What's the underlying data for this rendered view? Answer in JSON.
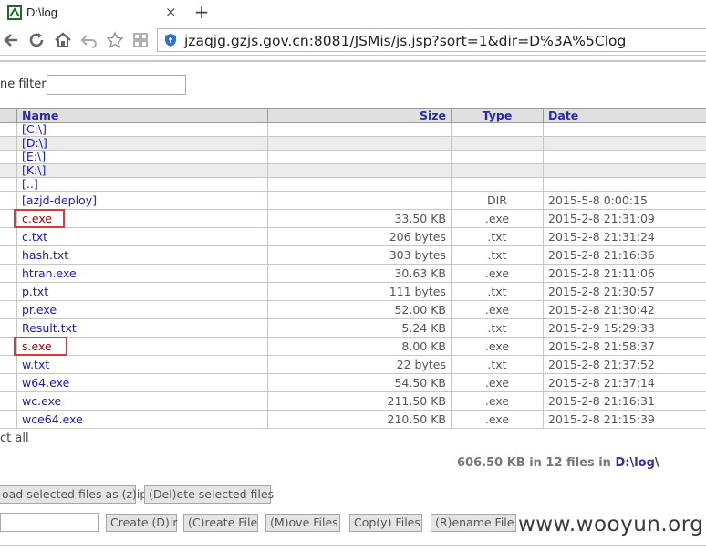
{
  "browser": {
    "tab_title": "D:\\log",
    "tab_close": "×",
    "new_tab": "+",
    "url": "jzaqjg.gzjs.gov.cn:8081/JSMis/js.jsp?sort=1&dir=D%3A%5Clog"
  },
  "filter": {
    "label": "ne filter:",
    "value": ""
  },
  "table": {
    "headers": {
      "name": "Name",
      "size": "Size",
      "type": "Type",
      "date": "Date"
    },
    "drives": [
      "[C:\\]",
      "[D:\\]",
      "[E:\\]",
      "[K:\\]",
      "[..]"
    ],
    "rows": [
      {
        "name": "[azjd-deploy]",
        "size": "",
        "type": "DIR",
        "date": "2015-5-8 0:00:15"
      },
      {
        "name": "c.exe",
        "size": "33.50 KB",
        "type": ".exe",
        "date": "2015-2-8 21:31:09"
      },
      {
        "name": "c.txt",
        "size": "206 bytes",
        "type": ".txt",
        "date": "2015-2-8 21:31:24"
      },
      {
        "name": "hash.txt",
        "size": "303 bytes",
        "type": ".txt",
        "date": "2015-2-8 21:16:36"
      },
      {
        "name": "htran.exe",
        "size": "30.63 KB",
        "type": ".exe",
        "date": "2015-2-8 21:11:06"
      },
      {
        "name": "p.txt",
        "size": "111 bytes",
        "type": ".txt",
        "date": "2015-2-8 21:30:57"
      },
      {
        "name": "pr.exe",
        "size": "52.00 KB",
        "type": ".exe",
        "date": "2015-2-8 21:30:42"
      },
      {
        "name": "Result.txt",
        "size": "5.24 KB",
        "type": ".txt",
        "date": "2015-2-9 15:29:33"
      },
      {
        "name": "s.exe",
        "size": "8.00 KB",
        "type": ".exe",
        "date": "2015-2-8 21:58:37"
      },
      {
        "name": "w.txt",
        "size": "22 bytes",
        "type": ".txt",
        "date": "2015-2-8 21:37:52"
      },
      {
        "name": "w64.exe",
        "size": "54.50 KB",
        "type": ".exe",
        "date": "2015-2-8 21:37:14"
      },
      {
        "name": "wc.exe",
        "size": "211.50 KB",
        "type": ".exe",
        "date": "2015-2-8 21:16:31"
      },
      {
        "name": "wce64.exe",
        "size": "210.50 KB",
        "type": ".exe",
        "date": "2015-2-8 21:15:39"
      }
    ]
  },
  "select_all": "ct all",
  "summary": {
    "text": "606.50 KB in 12 files in ",
    "dir": "D:\\log\\"
  },
  "buttons": {
    "download_zip": "oad selected files as (z)ip",
    "delete": "(Del)ete selected files",
    "create_dir": "Create (D)ir",
    "create_file": "(C)reate File",
    "move_files": "(M)ove Files",
    "copy_files": "Cop(y) Files",
    "rename_file": "(R)ename File"
  },
  "watermark": "www.wooyun.org",
  "colors": {
    "highlight": "#d13c3c",
    "link": "#1a1ab8",
    "header_bg": "#e0e0e0"
  }
}
